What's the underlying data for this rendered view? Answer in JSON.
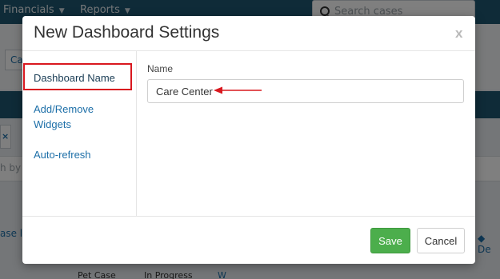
{
  "background": {
    "nav": [
      {
        "label": "Financials"
      },
      {
        "label": "Reports"
      }
    ],
    "search_placeholder": "Search cases",
    "tab_fragment": "Ca",
    "close_tab_glyph": "×",
    "search_row_fragment": "h by",
    "column_fragment_left": "ase lo",
    "column_fragment_right": "De",
    "row_cells": [
      "Pet Case",
      "In Progress",
      "W"
    ]
  },
  "modal": {
    "title": "New Dashboard Settings",
    "close_glyph": "x",
    "sidebar": [
      {
        "label": "Dashboard Name",
        "active": true
      },
      {
        "label": "Add/Remove Widgets",
        "active": false
      },
      {
        "label": "Auto-refresh",
        "active": false
      }
    ],
    "name_label": "Name",
    "name_value": "Care Center",
    "save_label": "Save",
    "cancel_label": "Cancel"
  },
  "colors": {
    "nav_bg": "#1f5670",
    "link": "#1d6fa8",
    "save_green": "#4cae4c",
    "annotation_red": "#d9181f"
  },
  "icons": {
    "search": "search-icon",
    "close": "close-icon",
    "annotation_arrow": "arrow-left-icon"
  }
}
